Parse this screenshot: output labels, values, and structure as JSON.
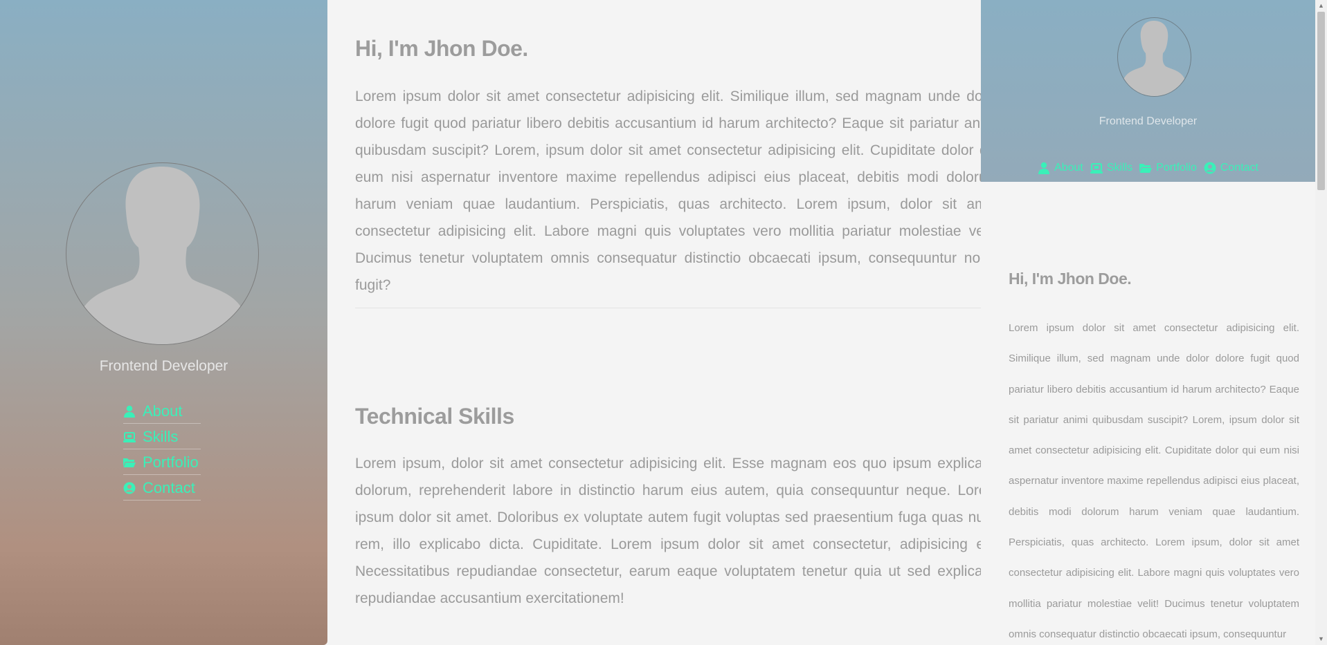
{
  "sidebar": {
    "role": "Frontend Developer",
    "nav": [
      {
        "label": "About",
        "icon": "user-icon"
      },
      {
        "label": "Skills",
        "icon": "laptop-icon"
      },
      {
        "label": "Portfolio",
        "icon": "folder-icon"
      },
      {
        "label": "Contact",
        "icon": "contact-icon"
      }
    ]
  },
  "main": {
    "title": "Hi, I'm Jhon Doe.",
    "intro": "Lorem ipsum dolor sit amet consectetur adipisicing elit. Similique illum, sed magnam unde dolor dolore fugit quod pariatur libero debitis accusantium id harum architecto? Eaque sit pariatur animi quibusdam suscipit? Lorem, ipsum dolor sit amet consectetur adipisicing elit. Cupiditate dolor qui eum nisi aspernatur inventore maxime repellendus adipisci eius placeat, debitis modi dolorum harum veniam quae laudantium. Perspiciatis, quas architecto. Lorem ipsum, dolor sit amet consectetur adipisicing elit. Labore magni quis voluptates vero mollitia pariatur molestiae velit! Ducimus tenetur voluptatem omnis consequatur distinctio obcaecati ipsum, consequuntur nobis fugit?",
    "skills_title": "Technical Skills",
    "skills_text": "Lorem ipsum, dolor sit amet consectetur adipisicing elit. Esse magnam eos quo ipsum explicabo dolorum, reprehenderit labore in distinctio harum eius autem, quia consequuntur neque. Lorem ipsum dolor sit amet. Doloribus ex voluptate autem fugit voluptas sed praesentium fuga quas nulla rem, illo explicabo dicta. Cupiditate. Lorem ipsum dolor sit amet consectetur, adipisicing elit. Necessitatibus repudiandae consectetur, earum eaque voluptatem tenetur quia ut sed explicabo repudiandae accusantium exercitationem!"
  },
  "preview": {
    "role": "Frontend Developer",
    "nav": [
      {
        "label": "About",
        "icon": "user-icon"
      },
      {
        "label": "Skills",
        "icon": "laptop-icon"
      },
      {
        "label": "Portfolio",
        "icon": "folder-icon"
      },
      {
        "label": "Contact",
        "icon": "contact-icon"
      }
    ],
    "title": "Hi, I'm Jhon Doe.",
    "text": "Lorem ipsum dolor sit amet consectetur adipisicing elit. Similique illum, sed magnam unde dolor dolore fugit quod pariatur libero debitis accusantium id harum architecto? Eaque sit pariatur animi quibusdam suscipit? Lorem, ipsum dolor sit amet consectetur adipisicing elit. Cupiditate dolor qui eum nisi aspernatur inventore maxime repellendus adipisci eius placeat, debitis modi dolorum harum veniam quae laudantium. Perspiciatis, quas architecto. Lorem ipsum, dolor sit amet consectetur adipisicing elit. Labore magni quis voluptates vero mollitia pariatur molestiae velit! Ducimus tenetur voluptatem omnis consequatur distinctio obcaecati ipsum, consequuntur"
  },
  "colors": {
    "accent": "#3af0b8",
    "sidebar_top": "#8aafc3",
    "sidebar_bottom": "#a08070",
    "text": "#9a9a9a",
    "background": "#f4f4f4"
  }
}
